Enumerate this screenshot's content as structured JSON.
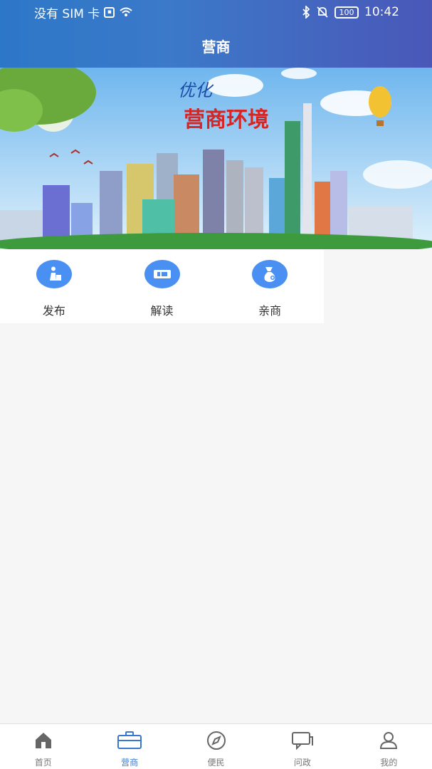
{
  "status_bar": {
    "carrier": "没有 SIM 卡",
    "sim_icon_text": "▣",
    "battery_text": "100",
    "time": "10:42"
  },
  "header": {
    "title": "营商"
  },
  "banner": {
    "title_top": "优化",
    "title_main": "营商环境"
  },
  "menu": {
    "items": [
      {
        "label": "发布",
        "icon": "publish-icon"
      },
      {
        "label": "解读",
        "icon": "interpret-icon"
      },
      {
        "label": "亲商",
        "icon": "pro-business-icon"
      }
    ]
  },
  "bottom_nav": {
    "items": [
      {
        "label": "首页",
        "icon": "home-icon"
      },
      {
        "label": "营商",
        "icon": "briefcase-icon",
        "active": true
      },
      {
        "label": "便民",
        "icon": "compass-icon"
      },
      {
        "label": "问政",
        "icon": "message-icon"
      },
      {
        "label": "我的",
        "icon": "user-icon"
      }
    ]
  },
  "colors": {
    "primary": "#3a78d0",
    "menu_icon_bg": "#4a8ff2",
    "background": "#f6f6f6"
  }
}
